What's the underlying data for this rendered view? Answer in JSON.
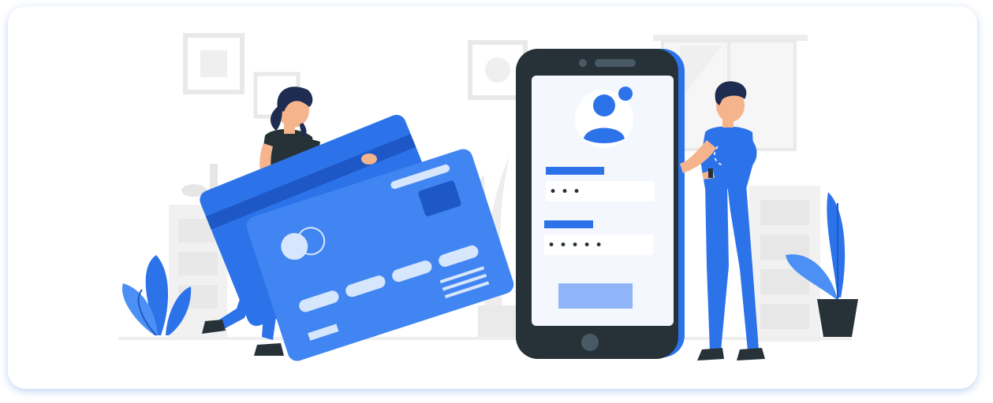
{
  "illustration": {
    "subject": "online-payment-login",
    "password_mask_1": "•••",
    "password_mask_2": "•••••",
    "colors": {
      "accent": "#2C73EA",
      "accent_light": "#4C90F6",
      "dark": "#263238",
      "background_gray": "#F5F5F5",
      "screen": "#F4F7FD",
      "skin": "#F5B48B",
      "hair": "#1F2C52"
    }
  }
}
